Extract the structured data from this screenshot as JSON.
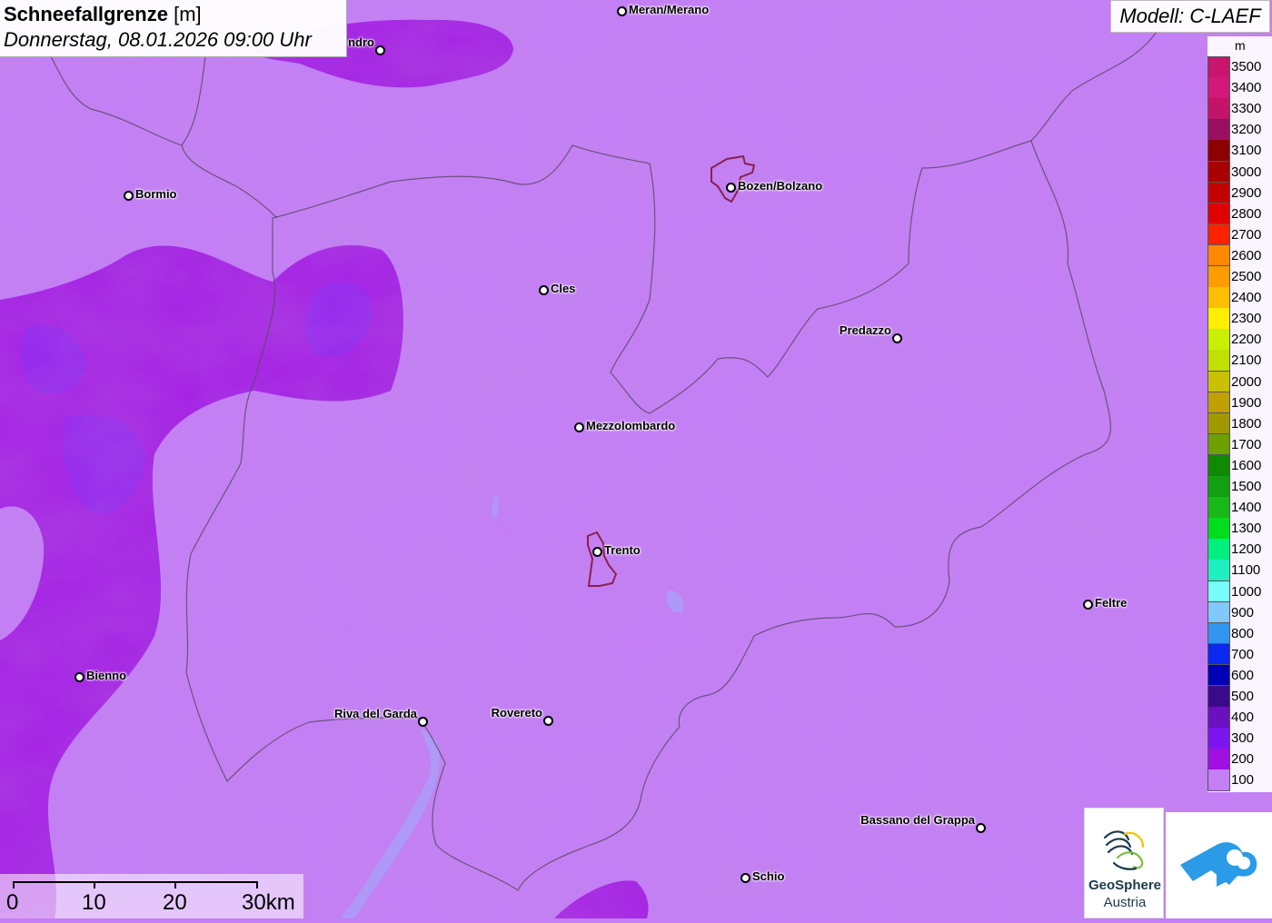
{
  "header": {
    "title_bold": "Schneefallgrenze",
    "title_unit": "[m]",
    "datetime": "Donnerstag, 08.01.2026 09:00 Uhr"
  },
  "model": {
    "label": "Modell: C-LAEF"
  },
  "legend": {
    "unit": "m",
    "entries": [
      {
        "label": "3500",
        "color": "#c8166e"
      },
      {
        "label": "3400",
        "color": "#d21878"
      },
      {
        "label": "3300",
        "color": "#c4146a"
      },
      {
        "label": "3200",
        "color": "#9a0f62"
      },
      {
        "label": "3100",
        "color": "#8c0000"
      },
      {
        "label": "3000",
        "color": "#a80000"
      },
      {
        "label": "2900",
        "color": "#c40000"
      },
      {
        "label": "2800",
        "color": "#e00000"
      },
      {
        "label": "2700",
        "color": "#ff2200"
      },
      {
        "label": "2600",
        "color": "#ff8800"
      },
      {
        "label": "2500",
        "color": "#ff9c00"
      },
      {
        "label": "2400",
        "color": "#ffbe00"
      },
      {
        "label": "2300",
        "color": "#ffee00"
      },
      {
        "label": "2200",
        "color": "#c8f000"
      },
      {
        "label": "2100",
        "color": "#c0e000"
      },
      {
        "label": "2000",
        "color": "#c8c000"
      },
      {
        "label": "1900",
        "color": "#c0a000"
      },
      {
        "label": "1800",
        "color": "#a09a00"
      },
      {
        "label": "1700",
        "color": "#6ea000"
      },
      {
        "label": "1600",
        "color": "#108a00"
      },
      {
        "label": "1500",
        "color": "#10a010"
      },
      {
        "label": "1400",
        "color": "#18b818"
      },
      {
        "label": "1300",
        "color": "#00dc1e"
      },
      {
        "label": "1200",
        "color": "#00f080"
      },
      {
        "label": "1100",
        "color": "#1ef0c0"
      },
      {
        "label": "1000",
        "color": "#78fcfc"
      },
      {
        "label": "900",
        "color": "#82c8fa"
      },
      {
        "label": "800",
        "color": "#3296f0"
      },
      {
        "label": "700",
        "color": "#0a28f0"
      },
      {
        "label": "600",
        "color": "#0000b4"
      },
      {
        "label": "500",
        "color": "#3a0a8a"
      },
      {
        "label": "400",
        "color": "#6a10c0"
      },
      {
        "label": "300",
        "color": "#7c14f0"
      },
      {
        "label": "200",
        "color": "#a010e0"
      },
      {
        "label": "100",
        "color": "#c47ef6"
      }
    ]
  },
  "cities": [
    {
      "name": "Meran/Merano",
      "side": "right"
    },
    {
      "name": "ndro",
      "side": "left"
    },
    {
      "name": "Bormio",
      "side": "right"
    },
    {
      "name": "Bozen/Bolzano",
      "side": "right"
    },
    {
      "name": "Cles",
      "side": "right"
    },
    {
      "name": "Predazzo",
      "side": "left"
    },
    {
      "name": "Mezzolombardo",
      "side": "right"
    },
    {
      "name": "Trento",
      "side": "right"
    },
    {
      "name": "Feltre",
      "side": "right"
    },
    {
      "name": "Bienno",
      "side": "right"
    },
    {
      "name": "Riva del Garda",
      "side": "left"
    },
    {
      "name": "Rovereto",
      "side": "left"
    },
    {
      "name": "Bassano del Grappa",
      "side": "left"
    },
    {
      "name": "Schio",
      "side": "right"
    }
  ],
  "scale_bar": {
    "labels": [
      "0",
      "10",
      "20",
      "30km"
    ]
  },
  "logos": {
    "geosphere_name": "GeoSphere",
    "geosphere_sub": "Austria"
  },
  "colors": {
    "base_field": "#c47ef6",
    "mid_field": "#a010e0",
    "deep_field": "#7c14f0",
    "lake": "#9ab0ff",
    "border": "#5a4a6a",
    "city_outline": "#8a2050"
  }
}
